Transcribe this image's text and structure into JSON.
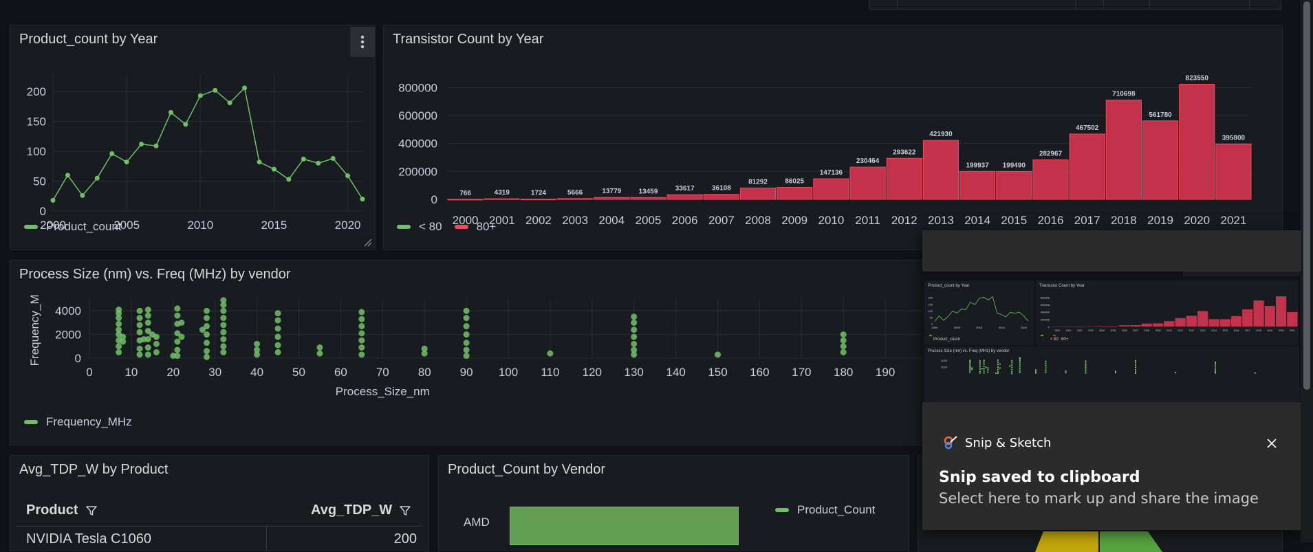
{
  "panels": {
    "product_count": {
      "title": "Product_count by Year",
      "menu_icon": "kebab-menu-icon",
      "legend": "Product_count",
      "color": "#73bf69"
    },
    "transistor": {
      "title": "Transistor Count by Year",
      "legend": [
        {
          "label": "< 80",
          "color": "#73bf69"
        },
        {
          "label": "80+",
          "color": "#f2495c"
        }
      ]
    },
    "process_size": {
      "title": "Process Size (nm) vs. Freq (MHz) by vendor",
      "legend": "Frequency_MHz",
      "xlabel": "Process_Size_nm",
      "ylabel": "Frequency_MI"
    },
    "avg_tdp": {
      "title": "Avg_TDP_W by Product",
      "columns": [
        "Product",
        "Avg_TDP_W"
      ],
      "filter_icon": "filter-icon",
      "rows": [
        [
          "NVIDIA Tesla C1060",
          "200"
        ]
      ]
    },
    "product_vendor": {
      "title": "Product_Count by Vendor",
      "legend": "Product_Count",
      "category": "AMD"
    }
  },
  "toast": {
    "app_name": "Snip & Sketch",
    "app_icon": "snip-sketch-icon",
    "close_icon": "close-icon",
    "title": "Snip saved to clipboard",
    "message": "Select here to mark up and share the image",
    "preview": {
      "panel1_title": "Product_count by Year",
      "panel2_title": "Transistor Count by Year",
      "panel3_title": "Process Size (nm) vs. Freq (MHz) by vendor",
      "panel1_legend": "Product_count",
      "panel2_legend": [
        "< 80",
        "80+"
      ],
      "panel1_yticks": [
        "200",
        "150",
        "100",
        "50",
        "0"
      ],
      "panel1_xticks": [
        "2000",
        "2005",
        "2010",
        "2015",
        "2020"
      ],
      "panel2_yticks": [
        "800000",
        "600000",
        "400000",
        "200000",
        "0"
      ],
      "panel2_xticks": [
        "2000",
        "2001",
        "2002",
        "2003",
        "2004",
        "2005",
        "2006",
        "2007",
        "2008",
        "2009",
        "2010",
        "2011",
        "2012",
        "2013",
        "2014",
        "2015",
        "2016",
        "2017",
        "2018",
        "2019",
        "2020",
        "2021"
      ],
      "panel3_yticks": [
        "4000",
        "2000"
      ]
    }
  },
  "chart_data": [
    {
      "type": "line",
      "name": "Product_count by Year",
      "x": [
        2000,
        2001,
        2002,
        2003,
        2004,
        2005,
        2006,
        2007,
        2008,
        2009,
        2010,
        2011,
        2012,
        2013,
        2014,
        2015,
        2016,
        2017,
        2018,
        2019,
        2020,
        2021
      ],
      "series": [
        {
          "name": "Product_count",
          "values": [
            18,
            60,
            26,
            55,
            96,
            82,
            112,
            109,
            165,
            145,
            193,
            202,
            181,
            206,
            82,
            70,
            53,
            87,
            80,
            88,
            59,
            20
          ]
        }
      ],
      "xlim": [
        2000,
        2021
      ],
      "ylim": [
        0,
        230
      ],
      "xticks": [
        2000,
        2005,
        2010,
        2015,
        2020
      ],
      "yticks": [
        0,
        50,
        100,
        150,
        200
      ],
      "grid": true,
      "legend_position": "bottom-left"
    },
    {
      "type": "bar",
      "name": "Transistor Count by Year",
      "categories": [
        "2000",
        "2001",
        "2002",
        "2003",
        "2004",
        "2005",
        "2006",
        "2007",
        "2008",
        "2009",
        "2010",
        "2011",
        "2012",
        "2013",
        "2014",
        "2015",
        "2016",
        "2017",
        "2018",
        "2019",
        "2020",
        "2021"
      ],
      "values": [
        766,
        4319,
        1724,
        5666,
        13779,
        13459,
        33617,
        36108,
        81292,
        86025,
        147136,
        230464,
        293622,
        421930,
        199937,
        199490,
        282967,
        467502,
        710698,
        561780,
        823550,
        395800
      ],
      "ylim": [
        0,
        900000
      ],
      "yticks": [
        0,
        200000,
        400000,
        600000,
        800000
      ],
      "grid": true,
      "legend_position": "bottom-left"
    },
    {
      "type": "scatter",
      "name": "Process Size (nm) vs. Freq (MHz) by vendor",
      "xlabel": "Process_Size_nm",
      "ylabel": "Frequency_MI",
      "xlim": [
        0,
        200
      ],
      "ylim": [
        0,
        5000
      ],
      "xticks": [
        0,
        10,
        20,
        30,
        40,
        50,
        60,
        70,
        80,
        90,
        100,
        110,
        120,
        130,
        140,
        150,
        160,
        170,
        180,
        190
      ],
      "yticks": [
        0,
        2000,
        4000
      ],
      "series": [
        {
          "name": "Frequency_MHz",
          "points": [
            [
              7,
              4100
            ],
            [
              7,
              3800
            ],
            [
              7,
              3400
            ],
            [
              7,
              2900
            ],
            [
              7,
              2400
            ],
            [
              7,
              2000
            ],
            [
              7,
              1500
            ],
            [
              7,
              1000
            ],
            [
              7,
              500
            ],
            [
              8,
              1800
            ],
            [
              8,
              1400
            ],
            [
              12,
              4000
            ],
            [
              12,
              3400
            ],
            [
              12,
              2800
            ],
            [
              12,
              2200
            ],
            [
              12,
              1500
            ],
            [
              12,
              800
            ],
            [
              12,
              300
            ],
            [
              13,
              1600
            ],
            [
              14,
              4100
            ],
            [
              14,
              3600
            ],
            [
              14,
              3000
            ],
            [
              14,
              2300
            ],
            [
              14,
              1600
            ],
            [
              14,
              900
            ],
            [
              14,
              300
            ],
            [
              15,
              2000
            ],
            [
              16,
              1800
            ],
            [
              16,
              1200
            ],
            [
              16,
              500
            ],
            [
              20,
              200
            ],
            [
              21,
              4200
            ],
            [
              21,
              3600
            ],
            [
              21,
              2900
            ],
            [
              21,
              2100
            ],
            [
              21,
              1400
            ],
            [
              21,
              700
            ],
            [
              21,
              200
            ],
            [
              22,
              3000
            ],
            [
              22,
              1800
            ],
            [
              28,
              4000
            ],
            [
              28,
              3400
            ],
            [
              28,
              2700
            ],
            [
              28,
              2000
            ],
            [
              28,
              1300
            ],
            [
              28,
              600
            ],
            [
              28,
              100
            ],
            [
              27,
              2400
            ],
            [
              32,
              4900
            ],
            [
              32,
              4500
            ],
            [
              32,
              4000
            ],
            [
              32,
              3400
            ],
            [
              32,
              2800
            ],
            [
              32,
              2200
            ],
            [
              32,
              1600
            ],
            [
              32,
              1000
            ],
            [
              32,
              500
            ],
            [
              40,
              1200
            ],
            [
              40,
              700
            ],
            [
              40,
              300
            ],
            [
              45,
              3800
            ],
            [
              45,
              3200
            ],
            [
              45,
              2500
            ],
            [
              45,
              1800
            ],
            [
              45,
              1100
            ],
            [
              45,
              500
            ],
            [
              55,
              900
            ],
            [
              55,
              400
            ],
            [
              65,
              3900
            ],
            [
              65,
              3300
            ],
            [
              65,
              2700
            ],
            [
              65,
              2100
            ],
            [
              65,
              1500
            ],
            [
              65,
              900
            ],
            [
              65,
              300
            ],
            [
              80,
              800
            ],
            [
              80,
              400
            ],
            [
              90,
              4000
            ],
            [
              90,
              3400
            ],
            [
              90,
              2700
            ],
            [
              90,
              2000
            ],
            [
              90,
              1300
            ],
            [
              90,
              700
            ],
            [
              90,
              200
            ],
            [
              110,
              400
            ],
            [
              130,
              3500
            ],
            [
              130,
              3000
            ],
            [
              130,
              2400
            ],
            [
              130,
              1800
            ],
            [
              130,
              1200
            ],
            [
              130,
              700
            ],
            [
              130,
              300
            ],
            [
              150,
              300
            ],
            [
              180,
              2000
            ],
            [
              180,
              1500
            ],
            [
              180,
              1000
            ],
            [
              180,
              500
            ]
          ]
        }
      ],
      "grid": true,
      "legend_position": "bottom-left"
    },
    {
      "type": "bar",
      "name": "Product_Count by Vendor",
      "orientation": "horizontal",
      "categories": [
        "AMD"
      ],
      "values": [
        null
      ]
    }
  ]
}
